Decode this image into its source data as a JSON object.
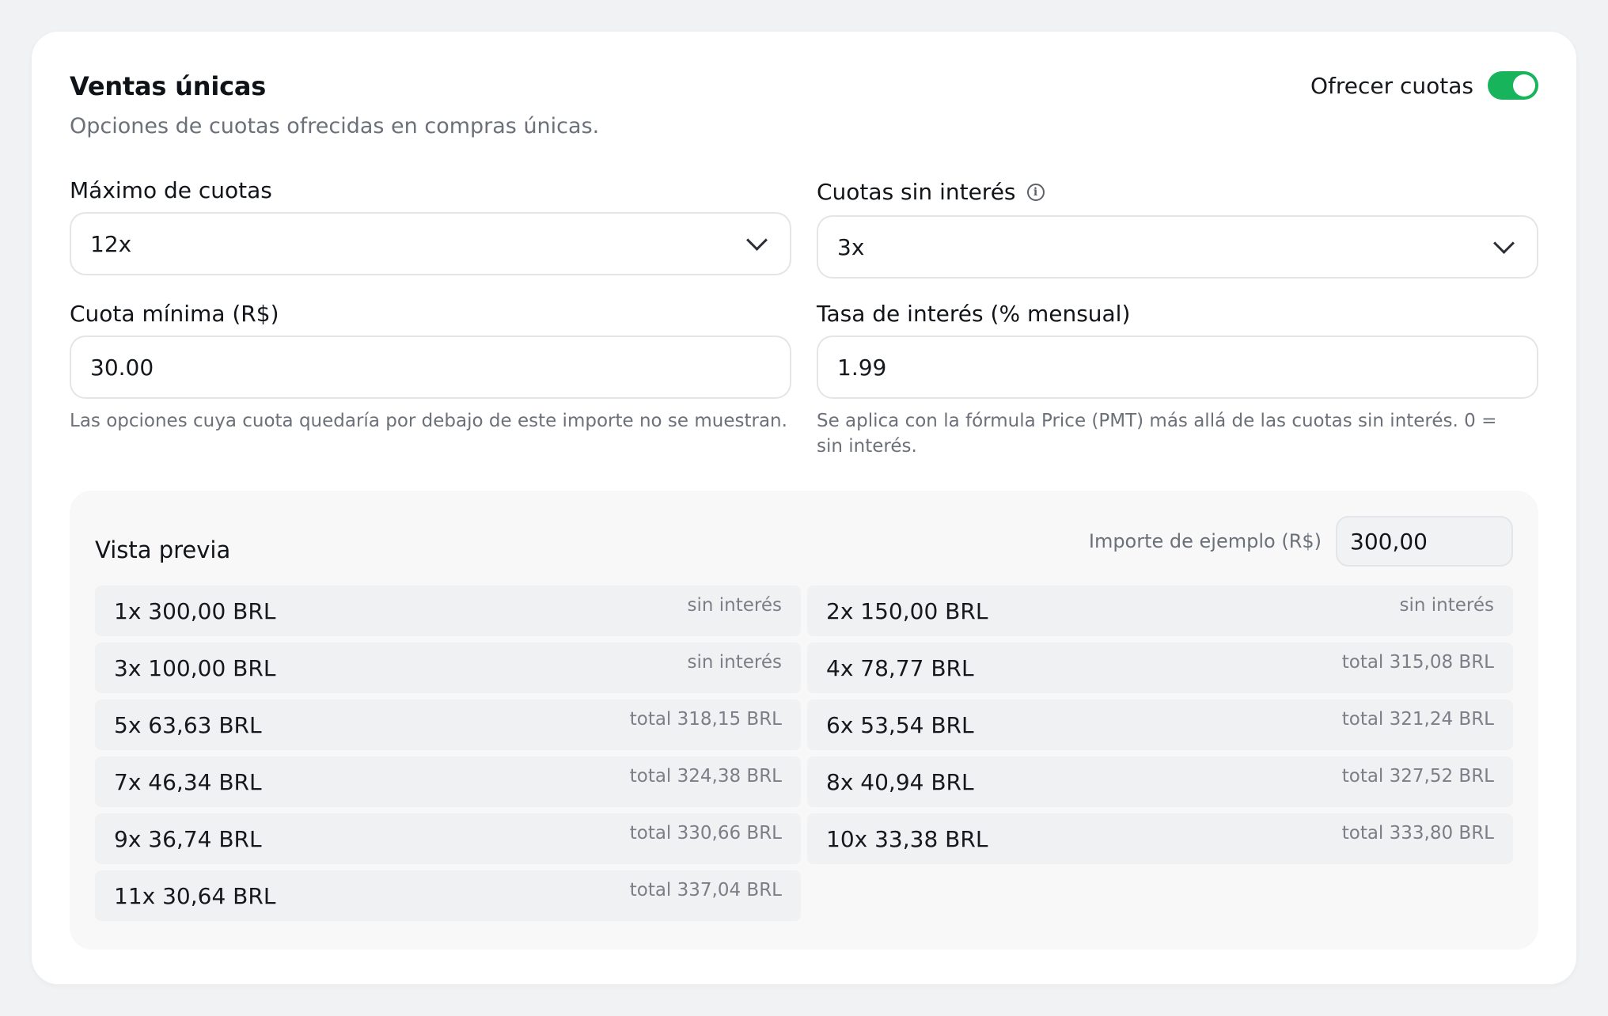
{
  "header": {
    "title": "Ventas únicas",
    "subtitle": "Opciones de cuotas ofrecidas en compras únicas.",
    "toggle_label": "Ofrecer cuotas",
    "toggle_on": true
  },
  "fields": {
    "max_installments": {
      "label": "Máximo de cuotas",
      "value": "12x"
    },
    "interest_free": {
      "label": "Cuotas sin interés",
      "value": "3x"
    },
    "min_installment": {
      "label": "Cuota mínima (R$)",
      "value": "30.00",
      "help": "Las opciones cuya cuota quedaría por debajo de este importe no se muestran."
    },
    "interest_rate": {
      "label": "Tasa de interés (% mensual)",
      "value": "1.99",
      "help": "Se aplica con la fórmula Price (PMT) más allá de las cuotas sin interés. 0 = sin interés."
    }
  },
  "preview": {
    "title": "Vista previa",
    "sample_label": "Importe de ejemplo (R$)",
    "sample_value": "300,00",
    "rows": [
      {
        "main": "1x 300,00 BRL",
        "note": "sin interés"
      },
      {
        "main": "2x 150,00 BRL",
        "note": "sin interés"
      },
      {
        "main": "3x 100,00 BRL",
        "note": "sin interés"
      },
      {
        "main": "4x 78,77 BRL",
        "note": "total 315,08 BRL"
      },
      {
        "main": "5x 63,63 BRL",
        "note": "total 318,15 BRL"
      },
      {
        "main": "6x 53,54 BRL",
        "note": "total 321,24 BRL"
      },
      {
        "main": "7x 46,34 BRL",
        "note": "total 324,38 BRL"
      },
      {
        "main": "8x 40,94 BRL",
        "note": "total 327,52 BRL"
      },
      {
        "main": "9x 36,74 BRL",
        "note": "total 330,66 BRL"
      },
      {
        "main": "10x 33,38 BRL",
        "note": "total 333,80 BRL"
      },
      {
        "main": "11x 30,64 BRL",
        "note": "total 337,04 BRL"
      }
    ]
  },
  "colors": {
    "accent": "#18b45b",
    "muted_text": "#6b7079",
    "border": "#e3e5e8"
  }
}
